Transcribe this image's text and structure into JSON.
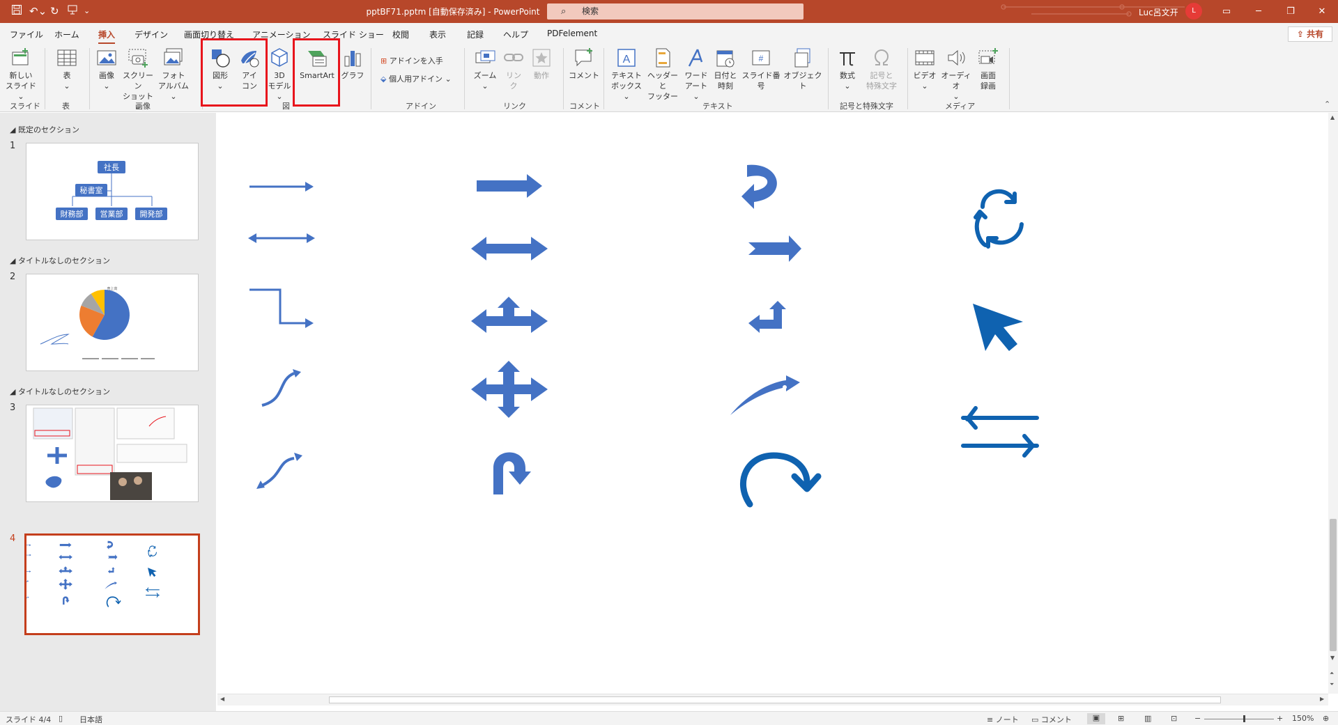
{
  "title_bar": {
    "document_title": "pptBF71.pptm [自動保存済み]  -  PowerPoint",
    "search_placeholder": "検索",
    "user_name": "Luc呂文开",
    "user_initial": "L"
  },
  "tabs": [
    "ファイル",
    "ホーム",
    "挿入",
    "デザイン",
    "画面切り替え",
    "アニメーション",
    "スライド ショー",
    "校閲",
    "表示",
    "記録",
    "ヘルプ",
    "PDFelement"
  ],
  "active_tab": "挿入",
  "share_label": "共有",
  "ribbon": {
    "new_slide": "新しい\nスライド ⌄",
    "table": "表\n⌄",
    "image": "画像\n⌄",
    "screenshot": "スクリーン\nショット ⌄",
    "photo_album": "フォト\nアルバム ⌄",
    "shapes": "図形\n⌄",
    "icons": "アイ\nコン",
    "model3d": "3D\nモデル ⌄",
    "smartart": "SmartArt",
    "graph": "グラフ",
    "get_addins": "アドインを入手",
    "my_addins": "個人用アドイン",
    "zoom": "ズーム\n⌄",
    "link": "リン\nク",
    "action": "動作",
    "comment": "コメント",
    "textbox": "テキスト\nボックス ⌄",
    "header_footer": "ヘッダーと\nフッター",
    "wordart": "ワード\nアート ⌄",
    "datetime": "日付と\n時刻",
    "slide_number": "スライド番号",
    "object": "オブジェクト",
    "equation": "数式\n⌄",
    "symbol": "記号と\n特殊文字",
    "video": "ビデオ\n⌄",
    "audio": "オーディオ\n⌄",
    "screen_record": "画面\n録画",
    "groups": {
      "slides": "スライド",
      "tables": "表",
      "images": "画像",
      "illustrations": "図",
      "addins": "アドイン",
      "links": "リンク",
      "comments": "コメント",
      "text": "テキスト",
      "symbols": "記号と特殊文字",
      "media": "メディア"
    }
  },
  "panel": {
    "sections": [
      "既定のセクション",
      "タイトルなしのセクション",
      "タイトルなしのセクション"
    ],
    "slide_numbers": [
      "1",
      "2",
      "3",
      "4"
    ],
    "slide1": {
      "top": "社長",
      "secretary": "秘書室",
      "departments": [
        "財務部",
        "営業部",
        "開発部"
      ]
    },
    "slide2": {
      "chart_title": "売上高"
    }
  },
  "chart_data": {
    "type": "pie",
    "title": "売上高",
    "values": [
      58,
      23,
      10,
      9
    ],
    "colors": [
      "#4472c4",
      "#ed7d31",
      "#a5a5a5",
      "#ffc000"
    ]
  },
  "status": {
    "slide_info": "スライド 4/4",
    "language": "日本語",
    "notes": "ノート",
    "comments": "コメント",
    "zoom": "150%"
  },
  "colors": {
    "brand": "#b7472a",
    "shape_blue": "#4472c4",
    "icon_blue": "#0f62b0",
    "highlight": "#e8141c"
  }
}
